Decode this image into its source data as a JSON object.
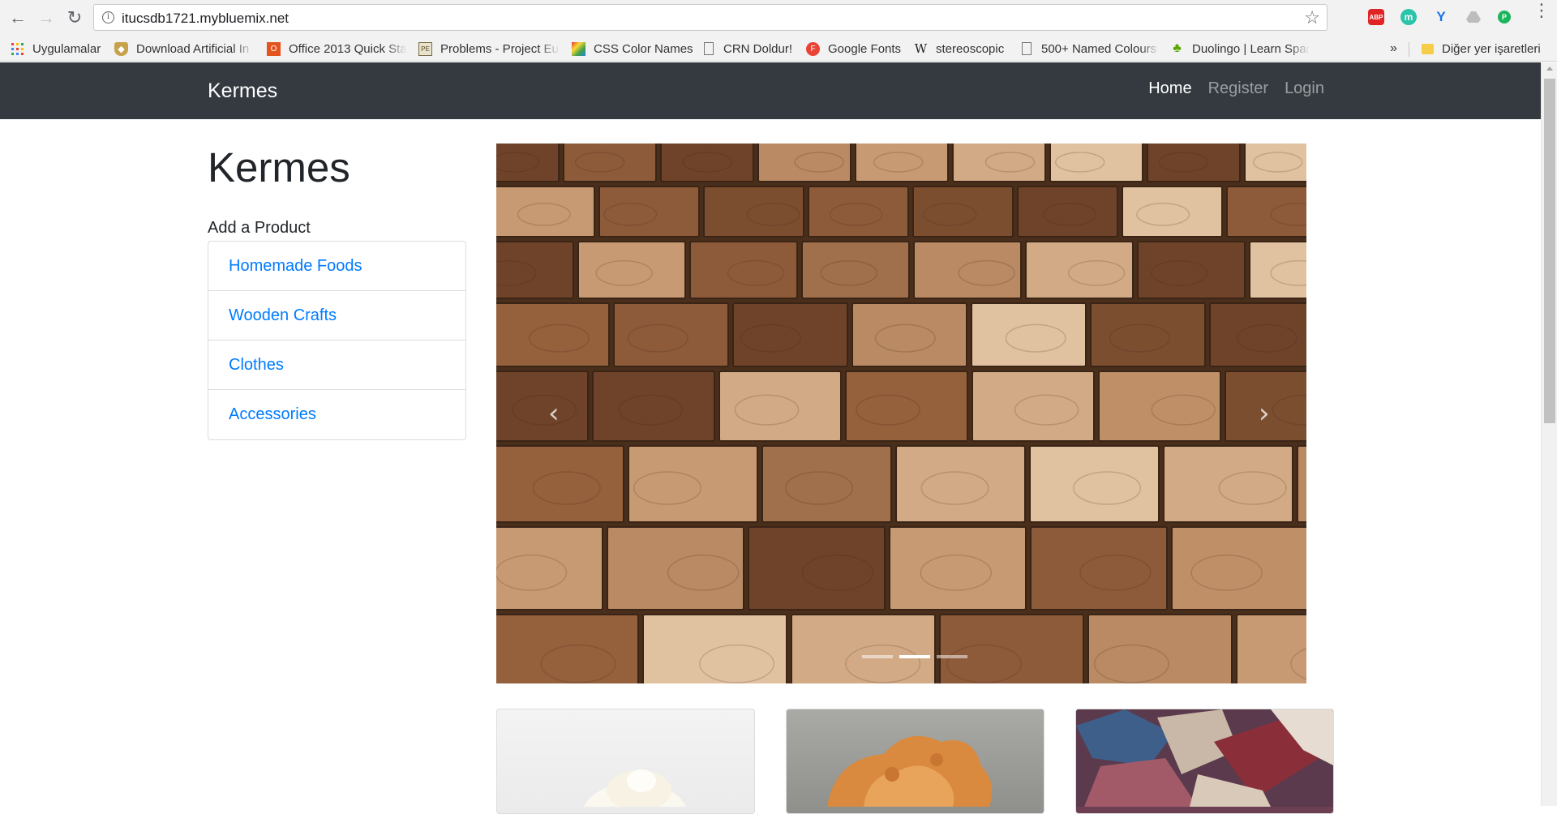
{
  "browser": {
    "url": "itucsdb1721.mybluemix.net",
    "bookmarks": [
      {
        "label": "Uygulamalar",
        "icon": "apps-grid-icon"
      },
      {
        "label": "Download Artificial In",
        "icon": "shield-icon"
      },
      {
        "label": "Office 2013 Quick Sta",
        "icon": "office-icon"
      },
      {
        "label": "Problems - Project Eu",
        "icon": "project-euler-icon"
      },
      {
        "label": "CSS Color Names",
        "icon": "color-icon"
      },
      {
        "label": "CRN Doldur!",
        "icon": "page-icon"
      },
      {
        "label": "Google Fonts",
        "icon": "google-fonts-icon"
      },
      {
        "label": "stereoscopic",
        "icon": "wikipedia-icon"
      },
      {
        "label": "500+ Named Colours",
        "icon": "page-icon"
      },
      {
        "label": "Duolingo | Learn Spar",
        "icon": "duolingo-icon"
      }
    ],
    "more_bookmarks": "»",
    "other_bookmarks": "Diğer yer işaretleri",
    "extensions": [
      "ABP",
      "m",
      "Y",
      "drive",
      "P"
    ]
  },
  "navbar": {
    "brand": "Kermes",
    "links": [
      {
        "label": "Home",
        "active": true
      },
      {
        "label": "Register",
        "active": false
      },
      {
        "label": "Login",
        "active": false
      }
    ]
  },
  "sidebar": {
    "title": "Kermes",
    "heading": "Add a Product",
    "categories": [
      "Homemade Foods",
      "Wooden Crafts",
      "Clothes",
      "Accessories"
    ]
  },
  "carousel": {
    "prev_icon": "‹",
    "next_icon": "›",
    "slides": 3,
    "active_slide": 2
  },
  "colors": {
    "navbar_bg": "#343a40",
    "link": "#007bff",
    "text": "#212529"
  }
}
